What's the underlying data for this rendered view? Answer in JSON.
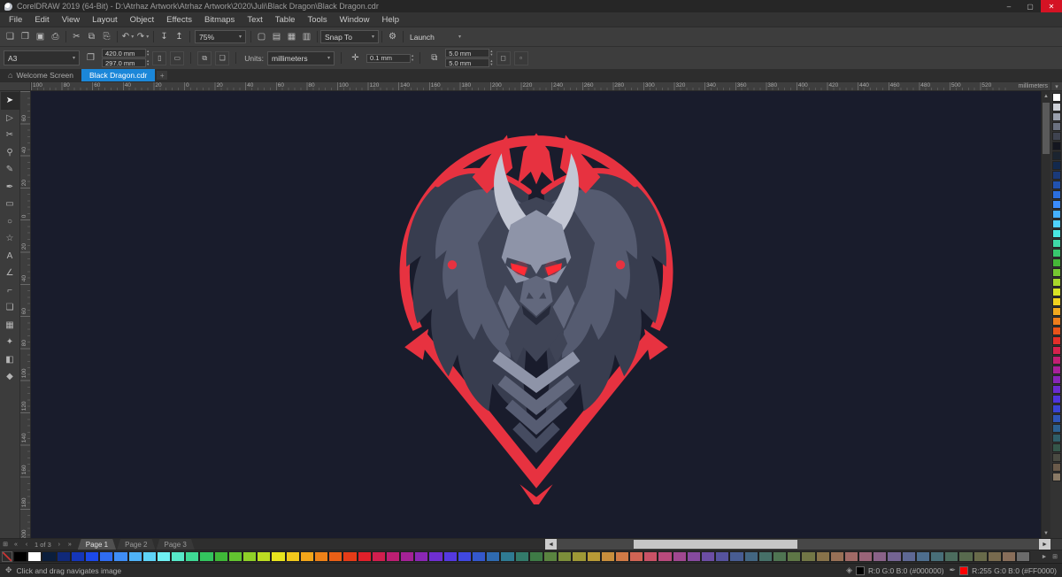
{
  "theme": {
    "red": "#e73240",
    "canvas_bg": "#191c2c",
    "accent_blue": "#1b87d9",
    "wing_dark": "#383d4f",
    "wing_mid": "#555b70",
    "horn": "#c3c7d4",
    "head_light": "#8e94a8",
    "head_mid": "#62687d",
    "head_dark": "#3f4456",
    "eye": "#ff2b35"
  },
  "titlebar": {
    "title": "CorelDRAW 2019 (64-Bit) - D:\\Atrhaz Artwork\\Atrhaz Artwork\\2020\\Juli\\Black Dragon\\Black Dragon.cdr",
    "minimize_glyph": "–",
    "maximize_glyph": "▢",
    "close_glyph": "✕"
  },
  "menubar": {
    "items": [
      "File",
      "Edit",
      "View",
      "Layout",
      "Object",
      "Effects",
      "Bitmaps",
      "Text",
      "Table",
      "Tools",
      "Window",
      "Help"
    ]
  },
  "standard_toolbar": {
    "file_buttons": [
      {
        "name": "new-document-button",
        "glyph": "❏"
      },
      {
        "name": "open-button",
        "glyph": "❒"
      },
      {
        "name": "save-button",
        "glyph": "▣"
      },
      {
        "name": "print-button",
        "glyph": "⎙"
      }
    ],
    "clipboard_buttons": [
      {
        "name": "cut-button",
        "glyph": "✂"
      },
      {
        "name": "copy-button",
        "glyph": "⧉"
      },
      {
        "name": "paste-button",
        "glyph": "⎘"
      }
    ],
    "undo_glyph": "↶",
    "redo_glyph": "↷",
    "import_export_buttons": [
      {
        "name": "import-button",
        "glyph": "↧"
      },
      {
        "name": "export-button",
        "glyph": "↥"
      }
    ],
    "zoom_value": "75%",
    "view_buttons": [
      {
        "name": "fullscreen-preview-button",
        "glyph": "▢"
      },
      {
        "name": "show-rulers-button",
        "glyph": "▤"
      },
      {
        "name": "show-grid-button",
        "glyph": "▦"
      },
      {
        "name": "show-guidelines-button",
        "glyph": "▥"
      }
    ],
    "snap_icon": "⌗",
    "snap_label": "Snap To",
    "options_glyph": "⚙",
    "launch_label": "Launch"
  },
  "property_bar": {
    "preset": "A3",
    "size_icon": "❐",
    "width_value": "420.0 mm",
    "height_value": "297.0 mm",
    "portrait_glyph": "▯",
    "landscape_glyph": "▭",
    "all_pages_glyph": "⧉",
    "current_page_glyph": "❏",
    "units_label": "Units:",
    "units_value": "millimeters",
    "nudge_icon": "✛",
    "nudge_value": "0.1 mm",
    "duplicate_icon": "⧉",
    "duplicate_x": "5.0 mm",
    "duplicate_y": "5.0 mm",
    "treat_as_filled_glyph": "◻",
    "more_options_glyph": "▫",
    "spin_up": "▴",
    "spin_down": "▾"
  },
  "document_tabs": {
    "home_icon": "⌂",
    "welcome": "Welcome Screen",
    "active_doc": "Black Dragon.cdr",
    "new_tab_glyph": "+"
  },
  "rulers": {
    "horizontal_labels": [
      "100",
      "80",
      "60",
      "40",
      "20",
      "0",
      "20",
      "40",
      "60",
      "80",
      "100",
      "120",
      "140",
      "160",
      "180",
      "200",
      "220",
      "240",
      "260",
      "280",
      "300",
      "320",
      "340",
      "360",
      "380",
      "400",
      "420",
      "440",
      "460",
      "480",
      "500",
      "520"
    ],
    "vertical_labels": [
      "60",
      "40",
      "20",
      "0",
      "20",
      "40",
      "60",
      "80",
      "100",
      "120",
      "140",
      "160",
      "180",
      "200"
    ],
    "unit_caption": "millimeters",
    "options_glyph": "▾"
  },
  "toolbox": {
    "tools": [
      {
        "name": "pick-tool",
        "glyph": "➤",
        "active": true
      },
      {
        "name": "shape-tool",
        "glyph": "▷"
      },
      {
        "name": "crop-tool",
        "glyph": "✂"
      },
      {
        "name": "zoom-tool",
        "glyph": "⚲"
      },
      {
        "name": "freehand-tool",
        "glyph": "✎"
      },
      {
        "name": "artistic-media-tool",
        "glyph": "✒"
      },
      {
        "name": "rectangle-tool",
        "glyph": "▭"
      },
      {
        "name": "ellipse-tool",
        "glyph": "○"
      },
      {
        "name": "polygon-tool",
        "glyph": "☆"
      },
      {
        "name": "text-tool",
        "glyph": "A"
      },
      {
        "name": "parallel-dimension-tool",
        "glyph": "∠"
      },
      {
        "name": "connector-tool",
        "glyph": "⌐"
      },
      {
        "name": "drop-shadow-tool",
        "glyph": "❏"
      },
      {
        "name": "transparency-tool",
        "glyph": "▦"
      },
      {
        "name": "color-eyedropper-tool",
        "glyph": "✦"
      },
      {
        "name": "interactive-fill-tool",
        "glyph": "◧"
      },
      {
        "name": "smart-fill-tool",
        "glyph": "◆"
      }
    ]
  },
  "scrollbars": {
    "up_glyph": "▲",
    "down_glyph": "▼",
    "left_glyph": "◄",
    "right_glyph": "►"
  },
  "pages": {
    "add_page_glyph": "⊞",
    "first_glyph": "«",
    "prev_glyph": "‹",
    "nav_info": "1 of 3",
    "next_glyph": "›",
    "last_glyph": "»",
    "tabs": [
      "Page 1",
      "Page 2",
      "Page 3"
    ],
    "active_tab": "Page 1"
  },
  "palettes": {
    "bottom": [
      "#000000",
      "#ffffff",
      "#0b1e3c",
      "#10297a",
      "#1536b8",
      "#1c49e8",
      "#2f6cf2",
      "#3f8df5",
      "#4fb2f7",
      "#5ed3f7",
      "#6ff0f2",
      "#57e8c8",
      "#3fd895",
      "#33c45e",
      "#3fb838",
      "#63c430",
      "#8fd028",
      "#bcdc22",
      "#e8e41e",
      "#f2c81c",
      "#f2a51a",
      "#ee8218",
      "#ea5f16",
      "#e63c18",
      "#e0202a",
      "#d01f4e",
      "#bc1f72",
      "#a42296",
      "#8a27b4",
      "#6f2fd0",
      "#5539e0",
      "#4048e0",
      "#3458cc",
      "#2f6ab0",
      "#2f7a92",
      "#337a6a",
      "#3e7a46",
      "#5a8440",
      "#7c8e3a",
      "#9e9836",
      "#b89a36",
      "#c88e3c",
      "#d07a46",
      "#d06454",
      "#c85266",
      "#b84a7c",
      "#a04890",
      "#864a9e",
      "#6c4ea4",
      "#56539e",
      "#485c92",
      "#436682",
      "#467068",
      "#4f7452",
      "#5e7646",
      "#727646",
      "#87724a",
      "#987056",
      "#a06a66",
      "#9a6478",
      "#8a6288",
      "#746492",
      "#5e6894",
      "#4e6e8e",
      "#486e78",
      "#4c6c5e",
      "#586a4e",
      "#686a4a",
      "#786a4e",
      "#886e5a",
      "#6b6b6b"
    ],
    "right": [
      "#ffffff",
      "#cfd2d8",
      "#9aa0ad",
      "#6b7180",
      "#3f4350",
      "#14161f",
      "#1b2430",
      "#13294d",
      "#1a3a7a",
      "#2152b0",
      "#2b6fe0",
      "#3b8cff",
      "#45b0ff",
      "#4fd2ff",
      "#49e8e2",
      "#3fd9a8",
      "#38c86e",
      "#45b838",
      "#76c832",
      "#a8d82c",
      "#d8e426",
      "#f2d21f",
      "#f2a81f",
      "#ee7d1c",
      "#e9531a",
      "#e42f2a",
      "#d6224d",
      "#c21f74",
      "#a8219a",
      "#8726b8",
      "#6a2cd0",
      "#4f35dc",
      "#3a44d4",
      "#2f55b8",
      "#2c6090",
      "#2f5e68",
      "#35564a",
      "#4a4a42",
      "#6a5a4a",
      "#8a7a66"
    ]
  },
  "statusbar": {
    "pan_icon": "✥",
    "message": "Click and drag navigates image",
    "fill_icon": "◈",
    "fill_swatch": "#000000",
    "fill_text": "R:0 G:0 B:0 (#000000)",
    "outline_icon": "✒",
    "outline_swatch": "#FF0000",
    "outline_text": "R:255 G:0 B:0 (#FF0000)"
  }
}
